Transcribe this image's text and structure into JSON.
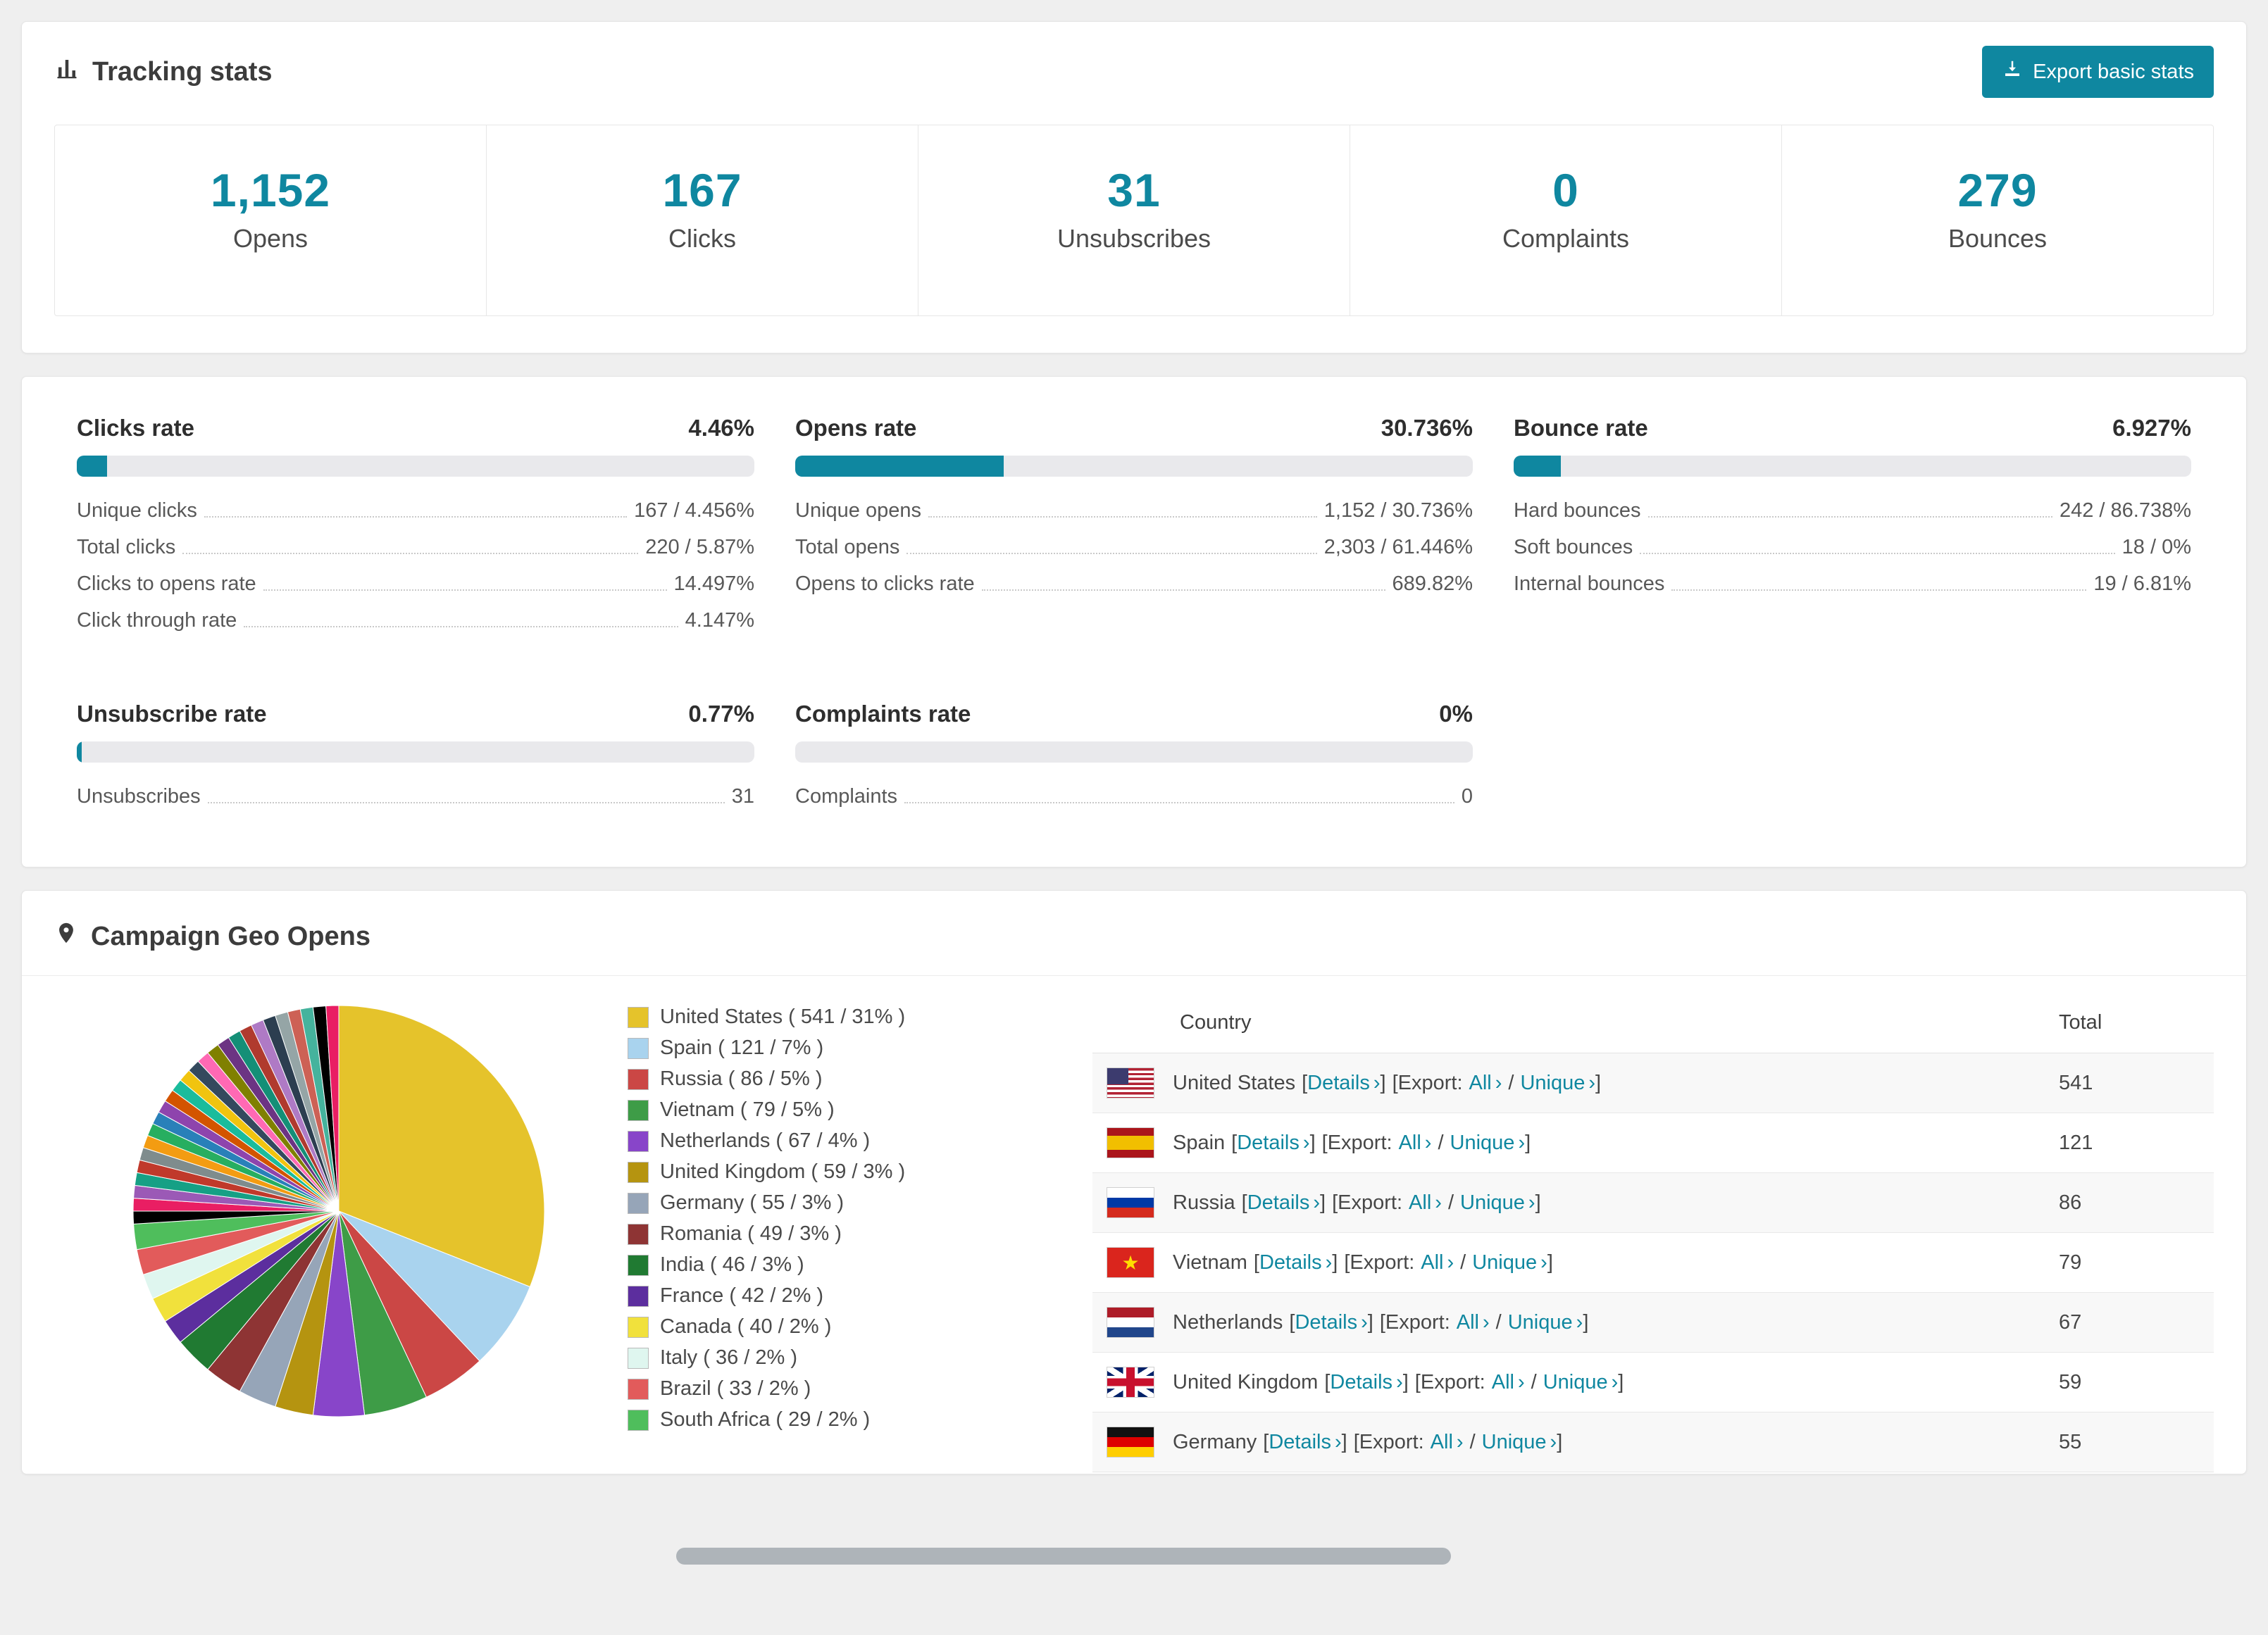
{
  "theme": {
    "accent": "#0F87A0",
    "page_bg": "#efefef"
  },
  "tracking": {
    "title": "Tracking stats",
    "export_label": "Export basic stats",
    "stats": [
      {
        "value": "1,152",
        "label": "Opens"
      },
      {
        "value": "167",
        "label": "Clicks"
      },
      {
        "value": "31",
        "label": "Unsubscribes"
      },
      {
        "value": "0",
        "label": "Complaints"
      },
      {
        "value": "279",
        "label": "Bounces"
      }
    ]
  },
  "rates": [
    {
      "title": "Clicks rate",
      "value": "4.46%",
      "percent": 4.46,
      "rows": [
        {
          "label": "Unique clicks",
          "value": "167 / 4.456%"
        },
        {
          "label": "Total clicks",
          "value": "220 / 5.87%"
        },
        {
          "label": "Clicks to opens rate",
          "value": "14.497%"
        },
        {
          "label": "Click through rate",
          "value": "4.147%"
        }
      ]
    },
    {
      "title": "Opens rate",
      "value": "30.736%",
      "percent": 30.736,
      "rows": [
        {
          "label": "Unique opens",
          "value": "1,152 / 30.736%"
        },
        {
          "label": "Total opens",
          "value": "2,303 / 61.446%"
        },
        {
          "label": "Opens to clicks rate",
          "value": "689.82%"
        }
      ]
    },
    {
      "title": "Bounce rate",
      "value": "6.927%",
      "percent": 6.927,
      "rows": [
        {
          "label": "Hard bounces",
          "value": "242 / 86.738%"
        },
        {
          "label": "Soft bounces",
          "value": "18 / 0%"
        },
        {
          "label": "Internal bounces",
          "value": "19 / 6.81%"
        }
      ]
    },
    {
      "title": "Unsubscribe rate",
      "value": "0.77%",
      "percent": 0.77,
      "rows": [
        {
          "label": "Unsubscribes",
          "value": "31"
        }
      ]
    },
    {
      "title": "Complaints rate",
      "value": "0%",
      "percent": 0,
      "rows": [
        {
          "label": "Complaints",
          "value": "0"
        }
      ]
    }
  ],
  "geo": {
    "title": "Campaign Geo Opens",
    "table": {
      "country_header": "Country",
      "total_header": "Total",
      "details_label": "Details",
      "export_label": "Export:",
      "all_label": "All",
      "unique_label": "Unique",
      "arrow": "›",
      "lb": "[",
      "rb": "]",
      "slash": "/",
      "rows": [
        {
          "country": "United States",
          "flag": "flag-us",
          "total": "541"
        },
        {
          "country": "Spain",
          "flag": "flag-es",
          "total": "121"
        },
        {
          "country": "Russia",
          "flag": "flag-ru",
          "total": "86"
        },
        {
          "country": "Vietnam",
          "flag": "flag-vn",
          "total": "79"
        },
        {
          "country": "Netherlands",
          "flag": "flag-nl",
          "total": "67"
        },
        {
          "country": "United Kingdom",
          "flag": "flag-gb",
          "total": "59"
        },
        {
          "country": "Germany",
          "flag": "flag-de",
          "total": "55"
        }
      ]
    }
  },
  "chart_data": {
    "type": "pie",
    "title": "Campaign Geo Opens",
    "legend_position": "right",
    "items": [
      {
        "label": "United States",
        "count": 541,
        "pct": 31,
        "color": "#E5C32B"
      },
      {
        "label": "Spain",
        "count": 121,
        "pct": 7,
        "color": "#A9D3EE"
      },
      {
        "label": "Russia",
        "count": 86,
        "pct": 5,
        "color": "#CB4745"
      },
      {
        "label": "Vietnam",
        "count": 79,
        "pct": 5,
        "color": "#3E9C47"
      },
      {
        "label": "Netherlands",
        "count": 67,
        "pct": 4,
        "color": "#8845C9"
      },
      {
        "label": "United Kingdom",
        "count": 59,
        "pct": 3,
        "color": "#B59410"
      },
      {
        "label": "Germany",
        "count": 55,
        "pct": 3,
        "color": "#96A5B8"
      },
      {
        "label": "Romania",
        "count": 49,
        "pct": 3,
        "color": "#8E3434"
      },
      {
        "label": "India",
        "count": 46,
        "pct": 3,
        "color": "#207A32"
      },
      {
        "label": "France",
        "count": 42,
        "pct": 2,
        "color": "#5C2E9E"
      },
      {
        "label": "Canada",
        "count": 40,
        "pct": 2,
        "color": "#F1E13C"
      },
      {
        "label": "Italy",
        "count": 36,
        "pct": 2,
        "color": "#DFF6EF"
      },
      {
        "label": "Brazil",
        "count": 33,
        "pct": 2,
        "color": "#E25B5B"
      },
      {
        "label": "South Africa",
        "count": 29,
        "pct": 2,
        "color": "#4FBE5C"
      }
    ],
    "others": {
      "percent_total": 26,
      "slice_count": 26,
      "colors": [
        "#000000",
        "#E91E63",
        "#9B59B6",
        "#16A085",
        "#C0392B",
        "#7F8C8D",
        "#F39C12",
        "#27AE60",
        "#2980B9",
        "#8E44AD",
        "#D35400",
        "#1ABC9C",
        "#F1C40F",
        "#34495E",
        "#FF69B4",
        "#808000",
        "#6C3483",
        "#148F77",
        "#B03A2E",
        "#AF7AC5",
        "#2C3E50",
        "#95A5A6",
        "#CD6155",
        "#45B39D"
      ]
    }
  }
}
